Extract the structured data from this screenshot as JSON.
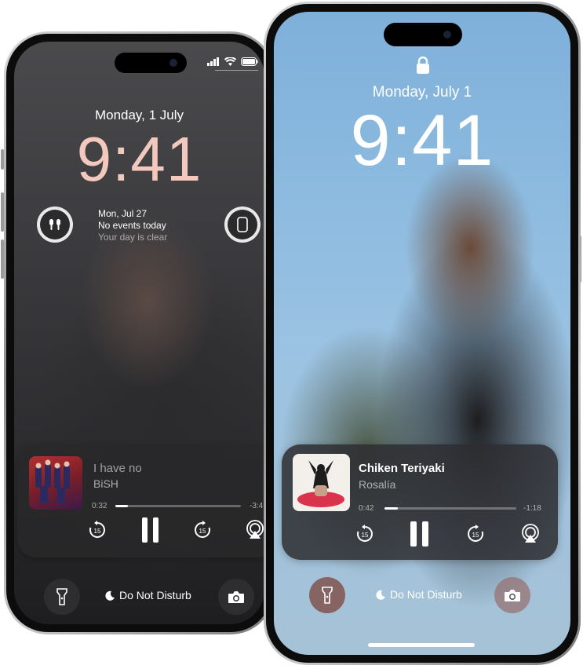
{
  "left_phone": {
    "date": "Monday, 1 July",
    "time": "9:41",
    "calendar": {
      "date": "Mon, Jul 27",
      "line1": "No events today",
      "line2": "Your day is clear"
    },
    "player": {
      "title": "I have no",
      "artist": "BiSH",
      "elapsed": "0:32",
      "remaining": "-3:4",
      "progress": 0.1
    },
    "dnd_label": "Do Not Disturb",
    "icons": {
      "flashlight": "flashlight-icon",
      "camera": "camera-icon",
      "airpods": "airpods-icon",
      "phone_battery": "phone-icon",
      "moon": "moon-icon"
    }
  },
  "right_phone": {
    "date": "Monday, July 1",
    "time": "9:41",
    "player": {
      "title": "Chiken Teriyaki",
      "artist": "Rosalía",
      "elapsed": "0:42",
      "remaining": "-1:18",
      "progress": 0.1
    },
    "skip_seconds": "15",
    "dnd_label": "Do Not Disturb",
    "icons": {
      "lock": "lock-icon",
      "flashlight": "flashlight-icon",
      "camera": "camera-icon",
      "moon": "moon-icon",
      "airplay": "airplay-icon"
    }
  },
  "colors": {
    "clock_left": "#f3c8bd",
    "clock_right": "#ffffff"
  }
}
